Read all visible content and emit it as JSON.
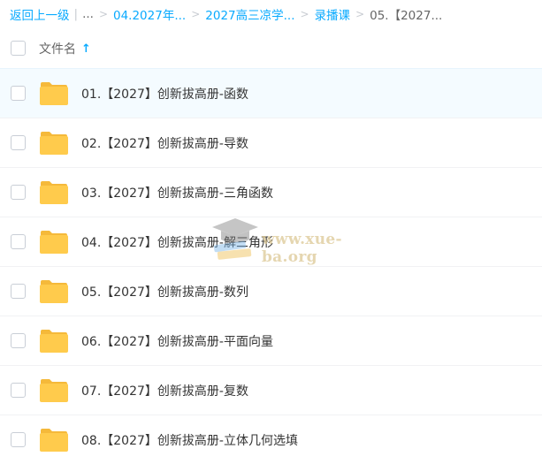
{
  "breadcrumb": {
    "back_label": "返回上一级",
    "ellipsis": "...",
    "items": [
      "04.2027年...",
      "2027高三凉学...",
      "录播课"
    ],
    "current": "05.【2027..."
  },
  "header": {
    "column_title": "文件名",
    "sort_icon": "arrow-up-icon"
  },
  "files": [
    {
      "name": "01.【2027】创新拔高册-函数"
    },
    {
      "name": "02.【2027】创新拔高册-导数"
    },
    {
      "name": "03.【2027】创新拔高册-三角函数"
    },
    {
      "name": "04.【2027】创新拔高册-解三角形"
    },
    {
      "name": "05.【2027】创新拔高册-数列"
    },
    {
      "name": "06.【2027】创新拔高册-平面向量"
    },
    {
      "name": "07.【2027】创新拔高册-复数"
    },
    {
      "name": "08.【2027】创新拔高册-立体几何选填"
    }
  ],
  "watermark": {
    "text": "www.xue-ba.org",
    "icon": "graduation-cap-icon"
  },
  "colors": {
    "accent": "#09AAFF",
    "folder": "#FFCB4C",
    "folder_dark": "#F5B93A",
    "hover_row": "#F4FBFF"
  }
}
